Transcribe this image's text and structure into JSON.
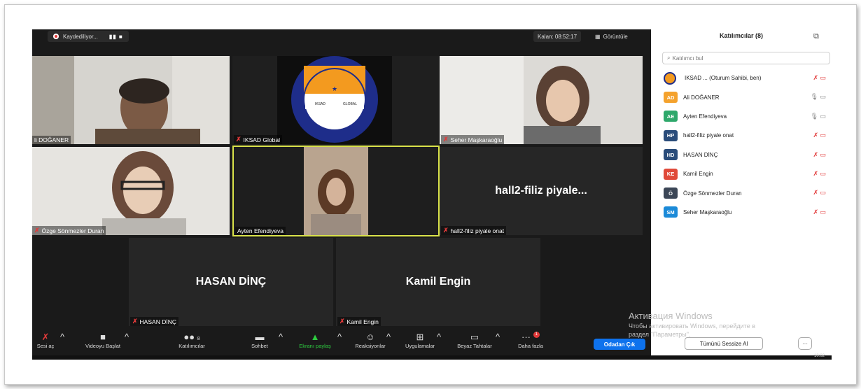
{
  "recording": {
    "label": "Kaydediliyor...",
    "controls": "▮▮ ■"
  },
  "remaining": "Kalan: 08:52:17",
  "view_label": "Görüntüle",
  "tiles": {
    "t1": "li DOĞANER",
    "t2": "IKSAD Global",
    "t3": "Seher Maşkaraoğlu",
    "t4": "Özge Sönmezler Duran",
    "t5": "Ayten Efendiyeva",
    "t6_big": "hall2-filiz  piyale...",
    "t6": "hall2-filiz piyale onat",
    "t7_big": "HASAN DİNÇ",
    "t7": "HASAN DİNÇ",
    "t8_big": "Kamil Engin",
    "t8": "Kamil Engin"
  },
  "logo_text": {
    "top": "SOCIAL RESEARCH ★ INSTITUTE OF ECONOMIC",
    "bottom": "DEVELOPMENT AND",
    "left": "IKSAD",
    "right": "GLOBAL"
  },
  "toolbar": {
    "unmute": "Sesi aç",
    "start_video": "Videoyu Başlat",
    "participants": "Katılımcılar",
    "participants_count": "8",
    "chat": "Sohbet",
    "share": "Ekranı paylaş",
    "reactions": "Reaksiyonlar",
    "apps": "Uygulamalar",
    "whiteboards": "Beyaz Tahtalar",
    "more": "Daha fazla",
    "more_badge": "1",
    "leave": "Odadan Çık"
  },
  "panel": {
    "title": "Katılımcılar (8)",
    "search_placeholder": "Katılımcı bul",
    "participants": [
      {
        "initials": "",
        "name": "IKSAD ... (Oturum Sahibi, ben)",
        "color": "#ffffff"
      },
      {
        "initials": "AD",
        "name": "Ali DOĞANER",
        "color": "#f4a22d"
      },
      {
        "initials": "AE",
        "name": "Ayten Efendiyeva",
        "color": "#2ea86b"
      },
      {
        "initials": "HP",
        "name": "hall2-filiz piyale onat",
        "color": "#2a4c7a"
      },
      {
        "initials": "HD",
        "name": "HASAN DİNÇ",
        "color": "#2a4c7a"
      },
      {
        "initials": "KE",
        "name": "Kamil Engin",
        "color": "#e04a3a"
      },
      {
        "initials": "Ö",
        "name": "Özge Sönmezler Duran",
        "color": "#3b4656"
      },
      {
        "initials": "SM",
        "name": "Seher Maşkaraoğlu",
        "color": "#1b8ad8"
      }
    ],
    "mute_all": "Tümünü Sessize Al",
    "more": "···"
  },
  "watermark": {
    "title": "Активация Windows",
    "line1": "Чтобы активировать Windows, перейдите в",
    "line2": "раздел \"Параметры\"."
  },
  "clock": "10:02"
}
